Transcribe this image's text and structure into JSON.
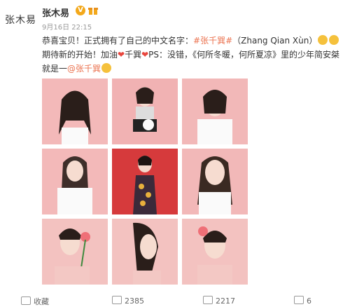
{
  "sidebar": {
    "avatar_name": "张木易"
  },
  "post": {
    "author": "张木易",
    "badge": "V",
    "time": "9月16日 22:15",
    "content": {
      "part1": "恭喜宝贝！正式拥有了自己的中文名字：",
      "tag1": "#张千巽#",
      "part2": "（Zhang Qian Xùn）",
      "part3": "期待新的开始！加油",
      "part4": "千巽",
      "part5": "PS：没错，《何所冬暖，何所夏凉》里的少年简安桀就是一",
      "mention": "@张千巽"
    },
    "actions": {
      "collect": "收藏",
      "repost": "2385",
      "comment": "2217",
      "like": "6"
    }
  },
  "colors": {
    "tag": "#eb7350",
    "heart": "#e8453c",
    "badge": "#f3a81b"
  }
}
